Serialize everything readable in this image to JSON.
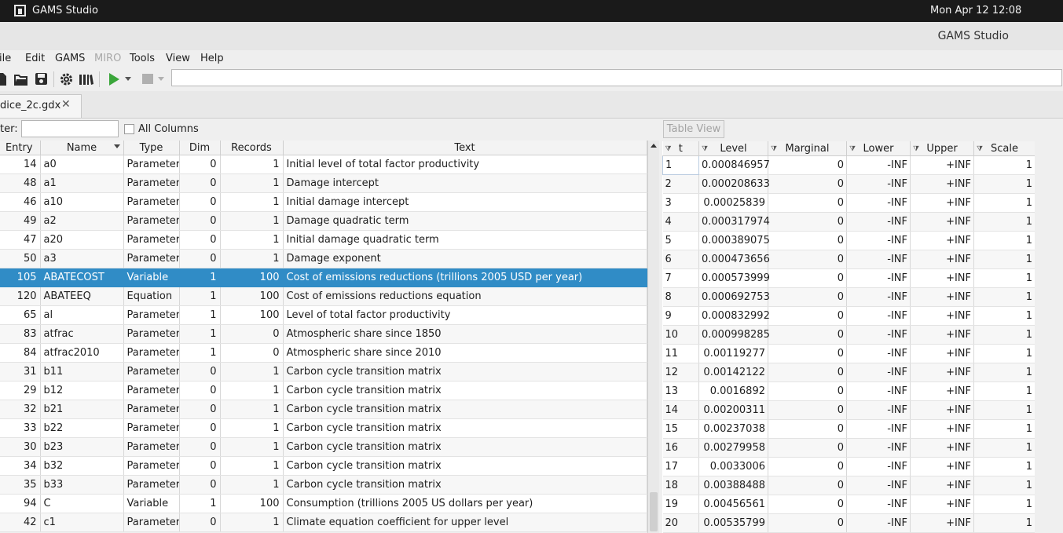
{
  "system": {
    "app_name": "GAMS Studio",
    "clock": "Mon Apr 12  12:08"
  },
  "window": {
    "title": "GAMS Studio"
  },
  "menu": [
    "File",
    "Edit",
    "GAMS",
    "MIRO",
    "Tools",
    "View",
    "Help"
  ],
  "menu_display": [
    "ile",
    "Edit",
    "GAMS",
    "MIRO",
    "Tools",
    "View",
    "Help"
  ],
  "tab": {
    "label": "dice_2c.gdx",
    "close": "✕"
  },
  "filter": {
    "label": "ter:",
    "value": "",
    "all_columns_label": "All Columns",
    "all_columns_checked": false
  },
  "table_view_button": "Table View",
  "symbol_table": {
    "headers": [
      "Entry",
      "Name",
      "Type",
      "Dim",
      "Records",
      "Text"
    ],
    "sort_column": "Name",
    "selected_row": 6,
    "rows": [
      [
        "14",
        "a0",
        "Parameter",
        "0",
        "1",
        "Initial level of total factor productivity"
      ],
      [
        "48",
        "a1",
        "Parameter",
        "0",
        "1",
        "Damage intercept"
      ],
      [
        "46",
        "a10",
        "Parameter",
        "0",
        "1",
        "Initial damage intercept"
      ],
      [
        "49",
        "a2",
        "Parameter",
        "0",
        "1",
        "Damage quadratic term"
      ],
      [
        "47",
        "a20",
        "Parameter",
        "0",
        "1",
        "Initial damage quadratic term"
      ],
      [
        "50",
        "a3",
        "Parameter",
        "0",
        "1",
        "Damage exponent"
      ],
      [
        "105",
        "ABATECOST",
        "Variable",
        "1",
        "100",
        "Cost of emissions reductions  (trillions 2005 USD per year)"
      ],
      [
        "120",
        "ABATEEQ",
        "Equation",
        "1",
        "100",
        "Cost of emissions reductions equation"
      ],
      [
        "65",
        "al",
        "Parameter",
        "1",
        "100",
        "Level of total factor productivity"
      ],
      [
        "83",
        "atfrac",
        "Parameter",
        "1",
        "0",
        "Atmospheric share since 1850"
      ],
      [
        "84",
        "atfrac2010",
        "Parameter",
        "1",
        "0",
        "Atmospheric share since 2010"
      ],
      [
        "31",
        "b11",
        "Parameter",
        "0",
        "1",
        "Carbon cycle transition matrix"
      ],
      [
        "29",
        "b12",
        "Parameter",
        "0",
        "1",
        "Carbon cycle transition matrix"
      ],
      [
        "32",
        "b21",
        "Parameter",
        "0",
        "1",
        "Carbon cycle transition matrix"
      ],
      [
        "33",
        "b22",
        "Parameter",
        "0",
        "1",
        "Carbon cycle transition matrix"
      ],
      [
        "30",
        "b23",
        "Parameter",
        "0",
        "1",
        "Carbon cycle transition matrix"
      ],
      [
        "34",
        "b32",
        "Parameter",
        "0",
        "1",
        "Carbon cycle transition matrix"
      ],
      [
        "35",
        "b33",
        "Parameter",
        "0",
        "1",
        "Carbon cycle transition matrix"
      ],
      [
        "94",
        "C",
        "Variable",
        "1",
        "100",
        "Consumption (trillions 2005 US dollars per year)"
      ],
      [
        "42",
        "c1",
        "Parameter",
        "0",
        "1",
        "Climate equation coefficient for upper level"
      ]
    ]
  },
  "value_table": {
    "headers": [
      "t",
      "Level",
      "Marginal",
      "Lower",
      "Upper",
      "Scale"
    ],
    "filter_icon": "⧩",
    "rows": [
      [
        "1",
        "0.000846957",
        "0",
        "-INF",
        "+INF",
        "1"
      ],
      [
        "2",
        "0.000208633",
        "0",
        "-INF",
        "+INF",
        "1"
      ],
      [
        "3",
        "0.00025839",
        "0",
        "-INF",
        "+INF",
        "1"
      ],
      [
        "4",
        "0.000317974",
        "0",
        "-INF",
        "+INF",
        "1"
      ],
      [
        "5",
        "0.000389075",
        "0",
        "-INF",
        "+INF",
        "1"
      ],
      [
        "6",
        "0.000473656",
        "0",
        "-INF",
        "+INF",
        "1"
      ],
      [
        "7",
        "0.000573999",
        "0",
        "-INF",
        "+INF",
        "1"
      ],
      [
        "8",
        "0.000692753",
        "0",
        "-INF",
        "+INF",
        "1"
      ],
      [
        "9",
        "0.000832992",
        "0",
        "-INF",
        "+INF",
        "1"
      ],
      [
        "10",
        "0.000998285",
        "0",
        "-INF",
        "+INF",
        "1"
      ],
      [
        "11",
        "0.00119277",
        "0",
        "-INF",
        "+INF",
        "1"
      ],
      [
        "12",
        "0.00142122",
        "0",
        "-INF",
        "+INF",
        "1"
      ],
      [
        "13",
        "0.0016892",
        "0",
        "-INF",
        "+INF",
        "1"
      ],
      [
        "14",
        "0.00200311",
        "0",
        "-INF",
        "+INF",
        "1"
      ],
      [
        "15",
        "0.00237038",
        "0",
        "-INF",
        "+INF",
        "1"
      ],
      [
        "16",
        "0.00279958",
        "0",
        "-INF",
        "+INF",
        "1"
      ],
      [
        "17",
        "0.0033006",
        "0",
        "-INF",
        "+INF",
        "1"
      ],
      [
        "18",
        "0.00388488",
        "0",
        "-INF",
        "+INF",
        "1"
      ],
      [
        "19",
        "0.00456561",
        "0",
        "-INF",
        "+INF",
        "1"
      ],
      [
        "20",
        "0.00535799",
        "0",
        "-INF",
        "+INF",
        "1"
      ]
    ]
  },
  "toolbar_icons": [
    "new-file-icon",
    "open-folder-icon",
    "save-icon",
    "settings-gear-icon",
    "model-library-icon",
    "run-icon",
    "run-dropdown-icon",
    "stop-icon",
    "stop-dropdown-icon"
  ],
  "colors": {
    "selection": "#308cc6",
    "run_green": "#3aa63a",
    "system_bar": "#1a1a1a"
  }
}
